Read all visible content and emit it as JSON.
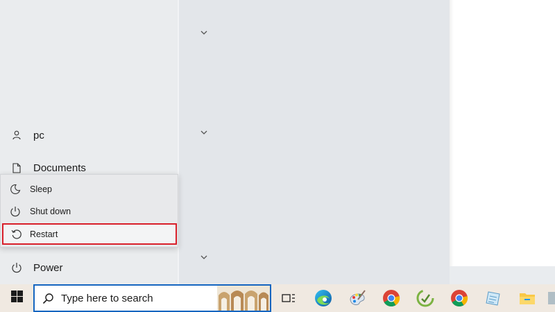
{
  "start_menu": {
    "rail": {
      "user": {
        "label": "pc",
        "icon": "person-icon"
      },
      "documents": {
        "label": "Documents",
        "icon": "document-icon"
      },
      "power": {
        "label": "Power",
        "icon": "power-icon"
      }
    },
    "power_menu": {
      "items": [
        {
          "label": "Sleep",
          "icon": "moon-icon"
        },
        {
          "label": "Shut down",
          "icon": "power-icon"
        },
        {
          "label": "Restart",
          "icon": "restart-icon",
          "highlighted": true
        }
      ]
    }
  },
  "taskbar": {
    "search": {
      "placeholder": "Type here to search"
    },
    "apps": [
      "task-view-icon",
      "edge-icon",
      "paint-icon",
      "chrome-icon",
      "green-app-icon",
      "chrome-icon",
      "notepad-icon",
      "file-explorer-icon"
    ]
  },
  "colors": {
    "highlight_border": "#d81f2a",
    "search_border": "#1565c0",
    "taskbar_background": "#f0e9e1"
  }
}
